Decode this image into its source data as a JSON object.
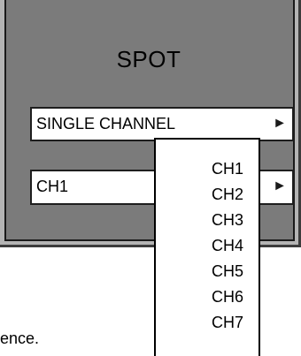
{
  "panel": {
    "title": "SPOT",
    "mode_select": {
      "value": "SINGLE CHANNEL",
      "arrow_icon": "black-triangle-right"
    },
    "channel_select": {
      "value": "CH1",
      "arrow_icon": "black-triangle-right"
    }
  },
  "dropdown": {
    "options": [
      "CH1",
      "CH2",
      "CH3",
      "CH4",
      "CH5",
      "CH6",
      "CH7"
    ]
  },
  "body_text": "ence.",
  "colors": {
    "panel_outer": "#b4b4b4",
    "panel_inner": "#7b7b7b",
    "border": "#1a1a1a",
    "field_bg": "#ffffff"
  }
}
